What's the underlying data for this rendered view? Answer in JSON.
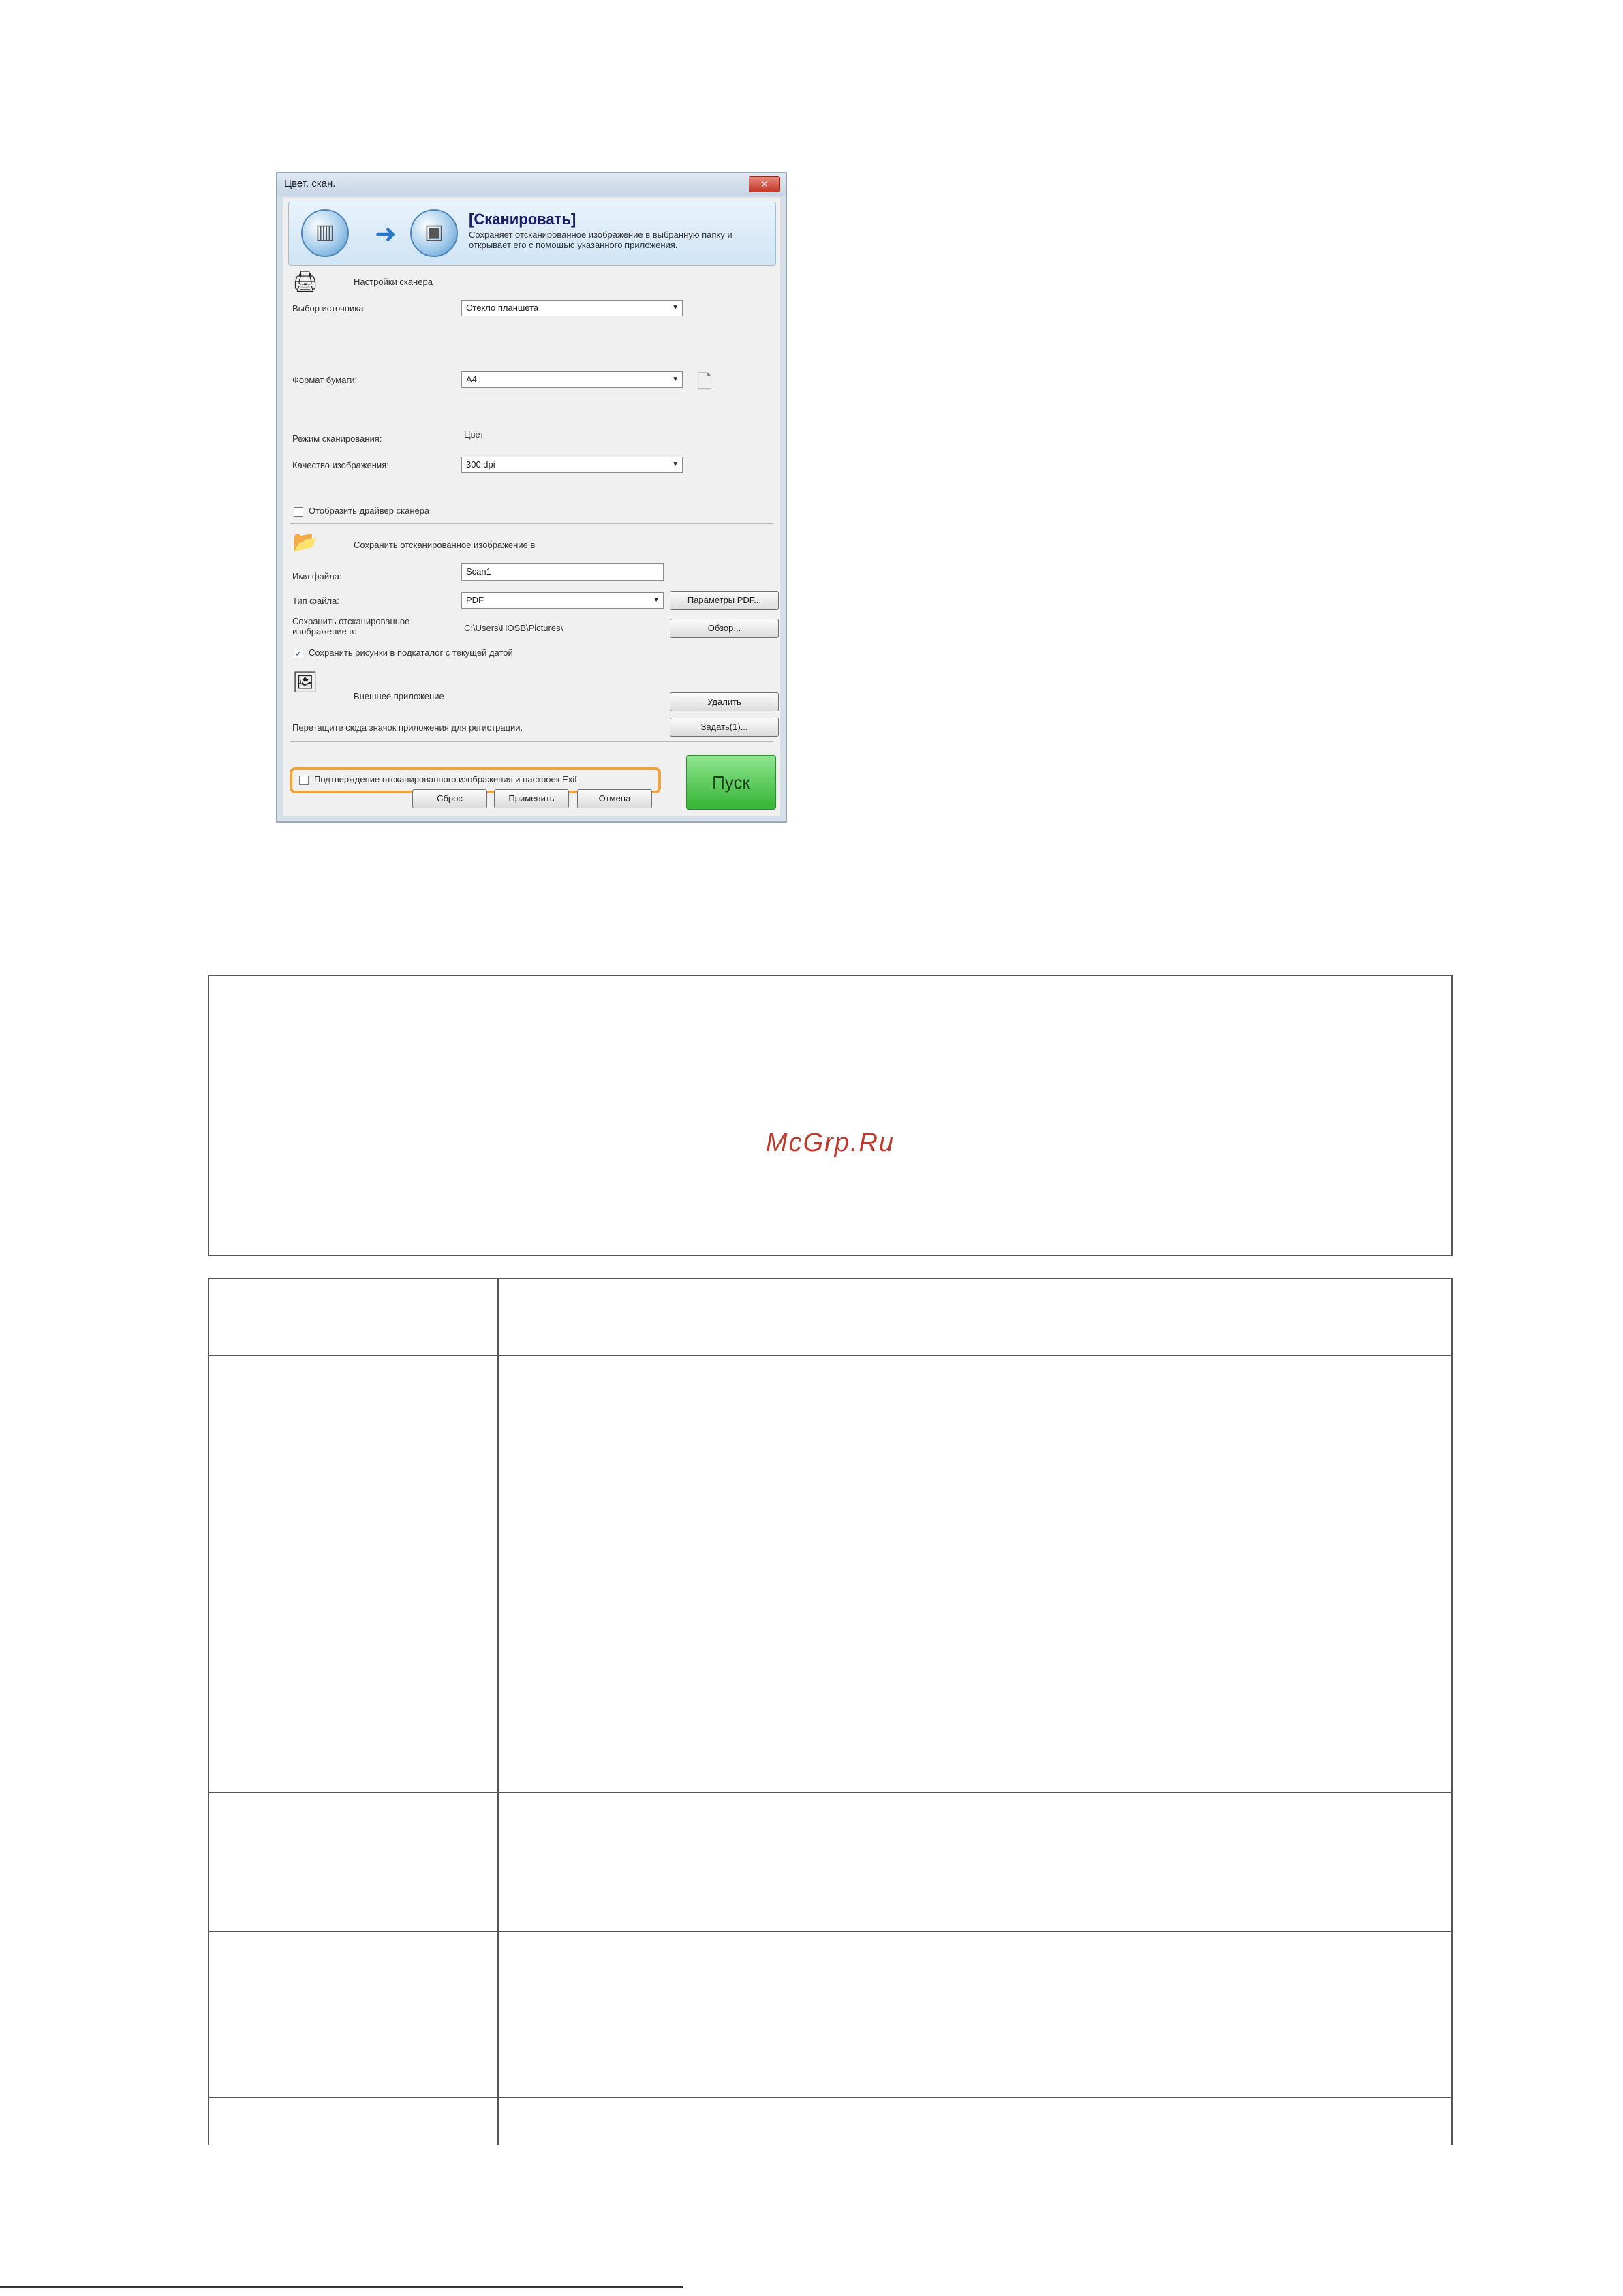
{
  "dialog": {
    "title": "Цвет. скан.",
    "close_symbol": "✕",
    "banner": {
      "heading": "[Сканировать]",
      "description": "Сохраняет отсканированное изображение в выбранную папку и открывает его с помощью указанного приложения."
    },
    "scanner_settings": {
      "section_title": "Настройки сканера",
      "source_label": "Выбор источника:",
      "source_value": "Стекло планшета",
      "paper_size_label": "Формат бумаги:",
      "paper_size_value": "A4",
      "scan_mode_label": "Режим сканирования:",
      "scan_mode_value": "Цвет",
      "image_quality_label": "Качество изображения:",
      "image_quality_value": "300 dpi",
      "show_driver_label": "Отобразить драйвер сканера"
    },
    "save_settings": {
      "section_title": "Сохранить отсканированное изображение в",
      "file_name_label": "Имя файла:",
      "file_name_value": "Scan1",
      "file_type_label": "Тип файла:",
      "file_type_value": "PDF",
      "pdf_params_button": "Параметры PDF...",
      "save_path_label": "Сохранить отсканированное изображение в:",
      "save_path_value": "C:\\Users\\HOSB\\Pictures\\",
      "browse_button": "Обзор...",
      "subfolder_label": "Сохранить рисунки в подкаталог с текущей датой"
    },
    "external_app": {
      "section_title": "Внешнее приложение",
      "delete_button": "Удалить",
      "drag_hint": "Перетащите сюда значок приложения для регистрации.",
      "set_button": "Задать(1)..."
    },
    "confirm_label": "Подтверждение отсканированного изображения и настроек Exif",
    "reset_button": "Сброс",
    "apply_button": "Применить",
    "cancel_button": "Отмена",
    "start_button": "Пуск"
  },
  "watermark": "McGrp.Ru",
  "colors": {
    "highlight": "#f1a23a",
    "start_button": "#35b435",
    "watermark": "#c0392b"
  }
}
